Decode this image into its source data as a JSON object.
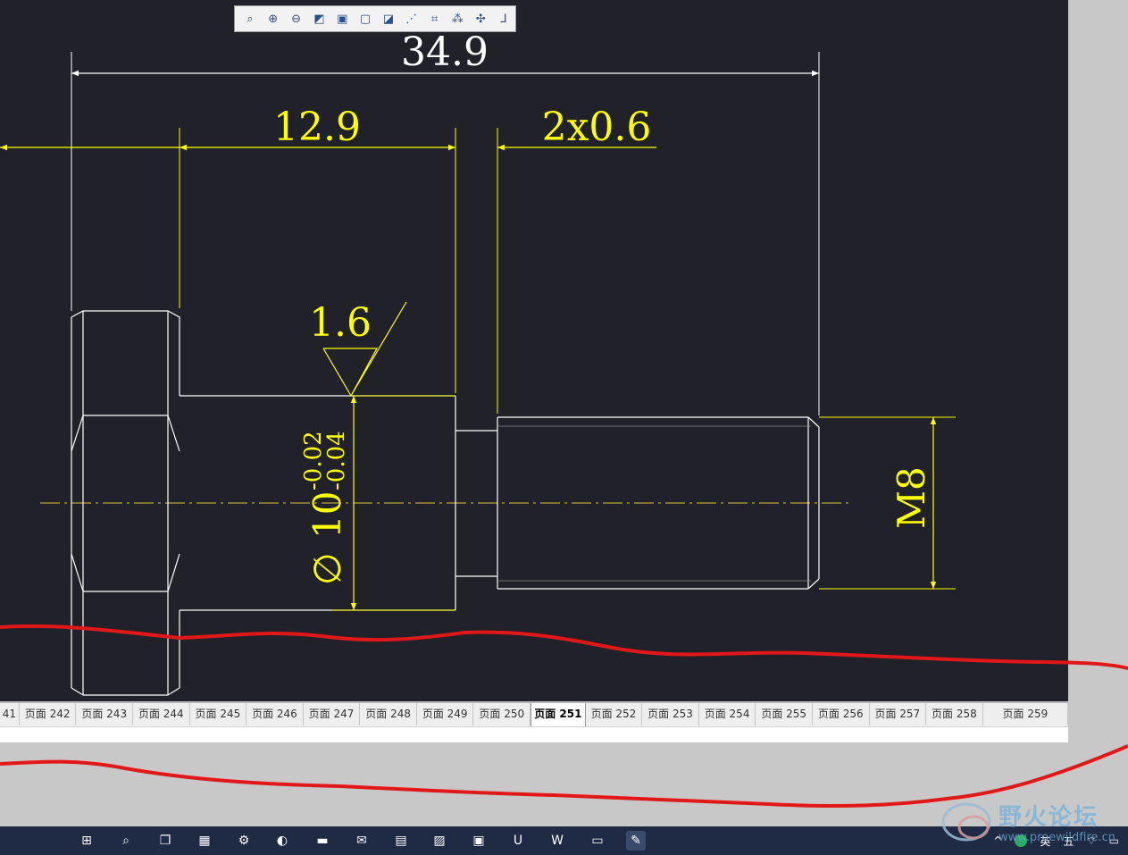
{
  "toolbar": {
    "buttons": [
      {
        "name": "zoom-window-icon",
        "glyph": "⌕"
      },
      {
        "name": "zoom-in-icon",
        "glyph": "⊕"
      },
      {
        "name": "zoom-out-icon",
        "glyph": "⊖"
      },
      {
        "name": "view-shaded-icon",
        "glyph": "◩"
      },
      {
        "name": "view-cube-icon",
        "glyph": "▣"
      },
      {
        "name": "view-wireframe-icon",
        "glyph": "▢"
      },
      {
        "name": "view-hidden-icon",
        "glyph": "◪"
      },
      {
        "name": "datum-planes-icon",
        "glyph": "⋰"
      },
      {
        "name": "datum-axes-icon",
        "glyph": "⌗"
      },
      {
        "name": "datum-points-icon",
        "glyph": "⁂"
      },
      {
        "name": "coordinate-system-icon",
        "glyph": "✣"
      },
      {
        "name": "annotation-display-icon",
        "glyph": "⅃"
      }
    ]
  },
  "drawing": {
    "dim_overall": "34.9",
    "dim_shoulder": "12.9",
    "dim_chamfer": "2x0.6",
    "surface_roughness": "1.6",
    "dim_diameter_symbol": "∅",
    "dim_diameter": "10",
    "tol_upper": "-0.02",
    "tol_lower": "-0.04",
    "dim_thread": "M8"
  },
  "tabs": [
    {
      "label": "41",
      "active": false
    },
    {
      "label": "页面 242",
      "active": false
    },
    {
      "label": "页面 243",
      "active": false
    },
    {
      "label": "页面 244",
      "active": false
    },
    {
      "label": "页面 245",
      "active": false
    },
    {
      "label": "页面 246",
      "active": false
    },
    {
      "label": "页面 247",
      "active": false
    },
    {
      "label": "页面 248",
      "active": false
    },
    {
      "label": "页面 249",
      "active": false
    },
    {
      "label": "页面 250",
      "active": false
    },
    {
      "label": "页面 251",
      "active": true
    },
    {
      "label": "页面 252",
      "active": false
    },
    {
      "label": "页面 253",
      "active": false
    },
    {
      "label": "页面 254",
      "active": false
    },
    {
      "label": "页面 255",
      "active": false
    },
    {
      "label": "页面 256",
      "active": false
    },
    {
      "label": "页面 257",
      "active": false
    },
    {
      "label": "页面 258",
      "active": false
    },
    {
      "label": "页面 259",
      "active": false
    }
  ],
  "taskbar": {
    "icons": [
      {
        "name": "start-icon",
        "glyph": "⊞"
      },
      {
        "name": "search-icon",
        "glyph": "⌕"
      },
      {
        "name": "task-view-icon",
        "glyph": "❐"
      },
      {
        "name": "widgets-icon",
        "glyph": "▦"
      },
      {
        "name": "settings-icon",
        "glyph": "⚙"
      },
      {
        "name": "edge-browser-icon",
        "glyph": "◐"
      },
      {
        "name": "file-explorer-icon",
        "glyph": "▬"
      },
      {
        "name": "mail-icon",
        "glyph": "✉"
      },
      {
        "name": "calculator-icon",
        "glyph": "▤"
      },
      {
        "name": "photos-icon",
        "glyph": "▨"
      },
      {
        "name": "store-icon",
        "glyph": "▣"
      },
      {
        "name": "pc-manager-icon",
        "glyph": "U"
      },
      {
        "name": "word-icon",
        "glyph": "W"
      },
      {
        "name": "remote-desktop-icon",
        "glyph": "▭"
      },
      {
        "name": "creo-app-icon",
        "glyph": "✎"
      }
    ],
    "tray": {
      "input_lang": "英",
      "input_mode": "五"
    }
  },
  "watermark": {
    "title": "野火论坛",
    "url": "www.proewildfire.cn"
  },
  "colors": {
    "canvas_bg": "#212129",
    "geometry": "#ffffff",
    "dimension": "#ffff00",
    "centerline": "#b8a23c",
    "markup": "#e01818"
  }
}
